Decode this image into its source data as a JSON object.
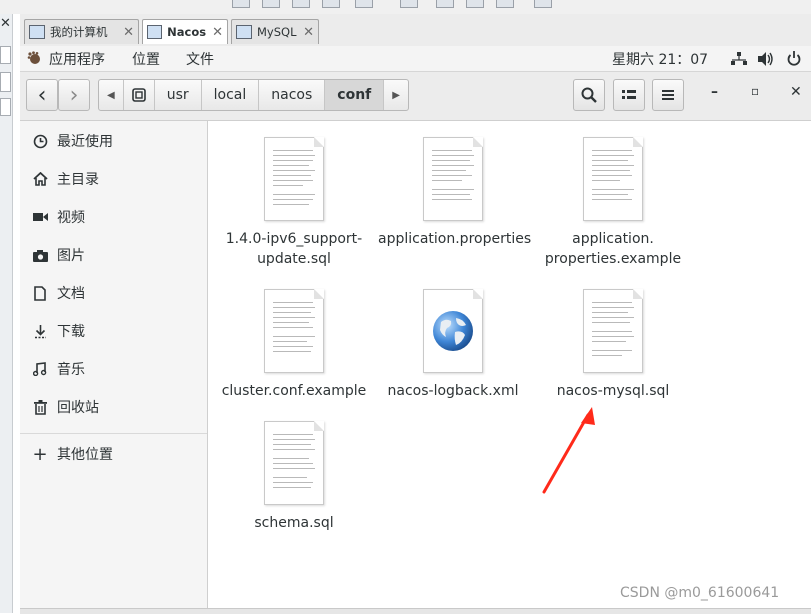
{
  "host": {
    "close_mark": "✕",
    "tabs": [
      {
        "label": "我的计算机",
        "close": "✕",
        "active": false
      },
      {
        "label": "Nacos",
        "close": "✕",
        "active": true
      },
      {
        "label": "MySQL",
        "close": "✕",
        "active": false
      }
    ]
  },
  "topbar": {
    "apps_label": "应用程序",
    "places_label": "位置",
    "files_label": "文件",
    "clock": "星期六 21：07",
    "network_icon": "network-icon",
    "volume_icon": "volume-icon",
    "power_icon": "power-icon"
  },
  "toolbar": {
    "back_icon": "‹",
    "forward_icon": "›",
    "path_left_arrow": "◀",
    "path_right_arrow": "▶",
    "path": [
      "usr",
      "local",
      "nacos",
      "conf"
    ],
    "active_segment": "conf",
    "minimize": "–",
    "maximize": "▫",
    "close": "✕"
  },
  "sidebar": {
    "items": [
      {
        "label": "最近使用",
        "icon": "recent-icon"
      },
      {
        "label": "主目录",
        "icon": "home-icon"
      },
      {
        "label": "视频",
        "icon": "video-icon"
      },
      {
        "label": "图片",
        "icon": "camera-icon"
      },
      {
        "label": "文档",
        "icon": "document-icon"
      },
      {
        "label": "下载",
        "icon": "download-icon"
      },
      {
        "label": "音乐",
        "icon": "music-icon"
      },
      {
        "label": "回收站",
        "icon": "trash-icon"
      }
    ],
    "other_locations": "其他位置"
  },
  "files": [
    {
      "name_lines": [
        "1.4.0-ipv6_support-",
        "update.sql"
      ],
      "icon": "text-file-icon"
    },
    {
      "name_lines": [
        "application.properties"
      ],
      "icon": "text-file-icon"
    },
    {
      "name_lines": [
        "application.",
        "properties.example"
      ],
      "icon": "text-file-icon"
    },
    {
      "name_lines": [
        "cluster.conf.example"
      ],
      "icon": "text-file-icon"
    },
    {
      "name_lines": [
        "nacos-logback.xml"
      ],
      "icon": "xml-globe-icon"
    },
    {
      "name_lines": [
        "nacos-mysql.sql"
      ],
      "icon": "text-file-icon"
    },
    {
      "name_lines": [
        "schema.sql"
      ],
      "icon": "text-file-icon"
    }
  ],
  "watermark": "CSDN @m0_61600641",
  "colors": {
    "arrow": "#ff2a1a",
    "active_segment": "#d7d7d7"
  }
}
